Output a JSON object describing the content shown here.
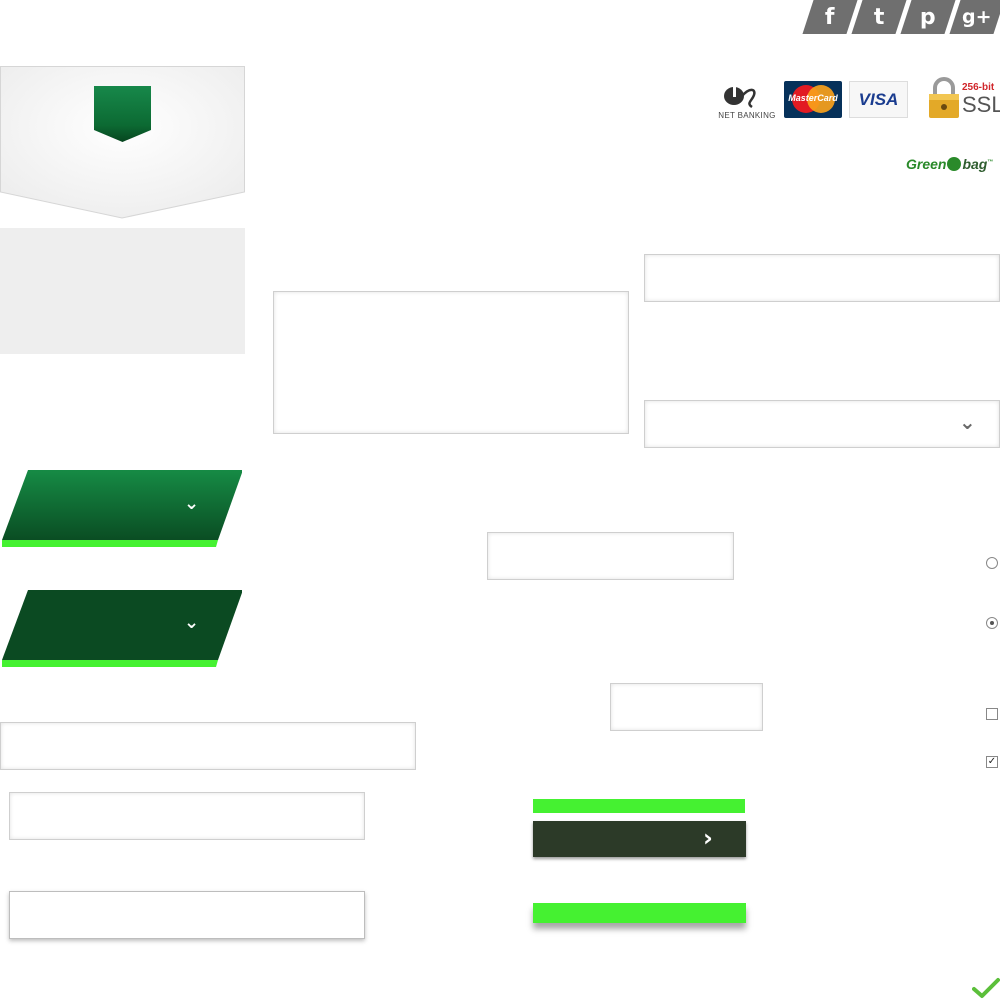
{
  "social": {
    "facebook_glyph": "f",
    "twitter_glyph": "t",
    "pinterest_glyph": "p",
    "googleplus_glyph": "g+"
  },
  "payment": {
    "net_banking_label": "NET BANKING",
    "mastercard_label": "MasterCard",
    "visa_label": "VISA",
    "ssl_bits": "256-bit",
    "ssl_label": "SSL"
  },
  "brand": {
    "green": "Green",
    "bag": "bag",
    "tm": "™"
  },
  "glyphs": {
    "chevron_down": "⌄",
    "chevron_right": "›",
    "check": "✓"
  },
  "colors": {
    "brand_green": "#0e6b32",
    "dark_green": "#0b4a22",
    "lime": "#45f131",
    "button_dark": "#2c3a28",
    "success_check": "#5bbf3a"
  },
  "controls": {
    "radio_1_checked": false,
    "radio_2_checked": true,
    "checkbox_1_checked": false,
    "checkbox_2_checked": true
  }
}
